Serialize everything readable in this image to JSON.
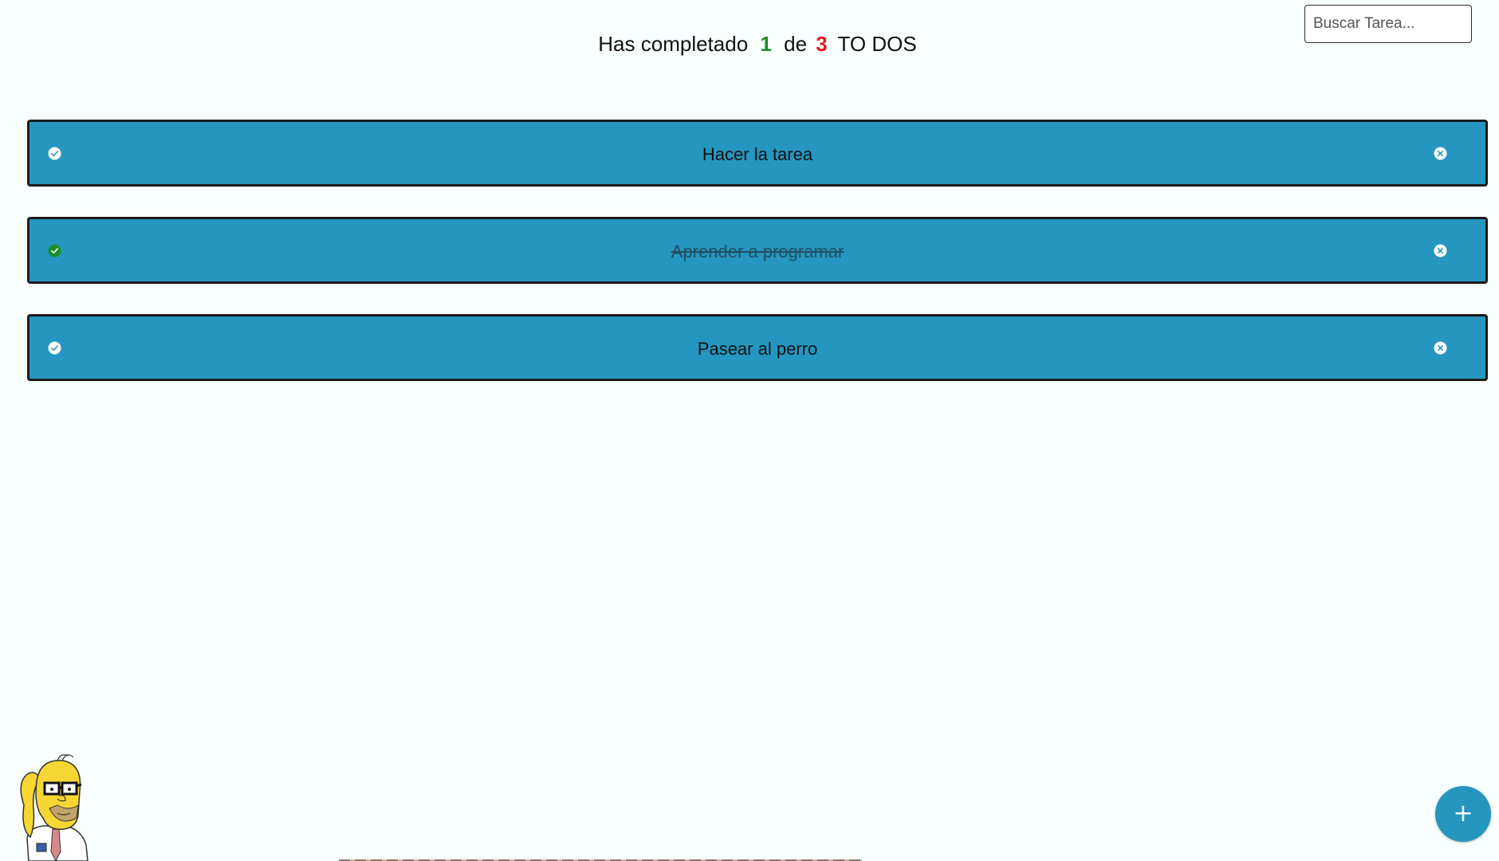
{
  "search": {
    "placeholder": "Buscar Tarea..."
  },
  "counter": {
    "prefix": "Has completado",
    "completed": "1",
    "middle": "de",
    "total": "3",
    "suffix": "TO DOS"
  },
  "todos": [
    {
      "text": "Hacer la tarea",
      "completed": false
    },
    {
      "text": "Aprender a programar",
      "completed": true
    },
    {
      "text": "Pasear al perro",
      "completed": false
    }
  ],
  "icons": {
    "check": "check-circle-icon",
    "delete": "close-circle-icon",
    "add": "plus-icon"
  },
  "add_button": {
    "label": "+"
  },
  "colors": {
    "background": "#f9fefe",
    "todo_background": "#2596c0",
    "todo_border": "#1b1b1b",
    "completed_count": "#1a8f2a",
    "total_count": "#e21d1d",
    "check_done": "#1a8f2a",
    "check_pending": "#ffffff",
    "add_button": "#2596c0"
  }
}
